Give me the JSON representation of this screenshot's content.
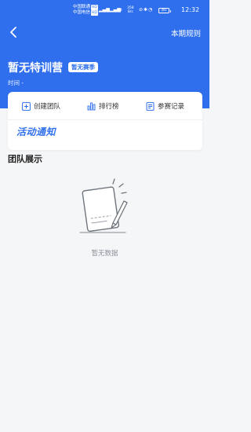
{
  "status_bar": {
    "carrier1": "中国联通",
    "carrier2": "中国电信",
    "carrier_tag": "HD",
    "speed_value": "358",
    "speed_unit": "B/s",
    "battery": "80",
    "time": "12:32"
  },
  "nav": {
    "rules_label": "本期规则"
  },
  "camp": {
    "title": "暂无特训营",
    "season_badge": "暂无赛季",
    "time_label": "时间",
    "time_value": "-"
  },
  "actions": [
    {
      "label": "创建团队",
      "icon": "add-square-icon"
    },
    {
      "label": "排行榜",
      "icon": "bar-chart-icon"
    },
    {
      "label": "参赛记录",
      "icon": "document-icon"
    }
  ],
  "notice": {
    "label": "活动通知"
  },
  "team_section": {
    "title": "团队展示",
    "empty_text": "暂无数据"
  },
  "colors": {
    "primary": "#2f6fee",
    "background": "#f5f6f8"
  }
}
